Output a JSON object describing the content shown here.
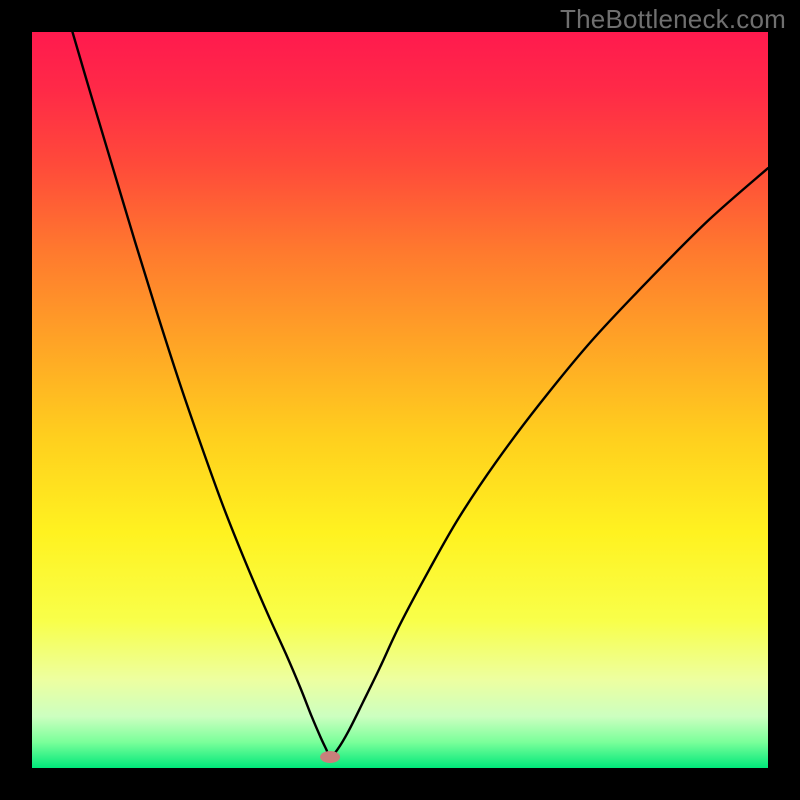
{
  "watermark": "TheBottleneck.com",
  "gradient": {
    "stops": [
      {
        "offset": 0.0,
        "color": "#ff1a4e"
      },
      {
        "offset": 0.08,
        "color": "#ff2a47"
      },
      {
        "offset": 0.18,
        "color": "#ff4a3a"
      },
      {
        "offset": 0.3,
        "color": "#ff7a2e"
      },
      {
        "offset": 0.42,
        "color": "#ffa326"
      },
      {
        "offset": 0.55,
        "color": "#ffcf1e"
      },
      {
        "offset": 0.68,
        "color": "#fff220"
      },
      {
        "offset": 0.8,
        "color": "#f8ff4a"
      },
      {
        "offset": 0.88,
        "color": "#edffa0"
      },
      {
        "offset": 0.93,
        "color": "#ccffc0"
      },
      {
        "offset": 0.965,
        "color": "#7aff9a"
      },
      {
        "offset": 1.0,
        "color": "#00e87a"
      }
    ]
  },
  "marker": {
    "x_frac": 0.405,
    "y_frac": 0.985,
    "color": "#c9807b",
    "rx": 10,
    "ry": 6
  },
  "chart_data": {
    "type": "line",
    "title": "",
    "xlabel": "",
    "ylabel": "",
    "xlim": [
      0,
      1
    ],
    "ylim": [
      0,
      1
    ],
    "note": "Axes are unlabeled in source; x and y are normalized fractions of the visible plot area (0,0)=top-left, (1,1)=bottom-right. Single black curve plunging to a minimum near x≈0.405 then rising.",
    "series": [
      {
        "name": "curve",
        "x": [
          0.055,
          0.08,
          0.11,
          0.14,
          0.17,
          0.2,
          0.23,
          0.26,
          0.29,
          0.32,
          0.345,
          0.365,
          0.38,
          0.392,
          0.4,
          0.405,
          0.415,
          0.43,
          0.45,
          0.472,
          0.5,
          0.54,
          0.58,
          0.63,
          0.69,
          0.76,
          0.84,
          0.92,
          1.0
        ],
        "y": [
          0.0,
          0.085,
          0.185,
          0.285,
          0.382,
          0.475,
          0.562,
          0.645,
          0.72,
          0.79,
          0.845,
          0.892,
          0.93,
          0.958,
          0.975,
          0.985,
          0.975,
          0.95,
          0.91,
          0.865,
          0.805,
          0.73,
          0.66,
          0.585,
          0.505,
          0.42,
          0.335,
          0.255,
          0.185
        ]
      }
    ]
  }
}
